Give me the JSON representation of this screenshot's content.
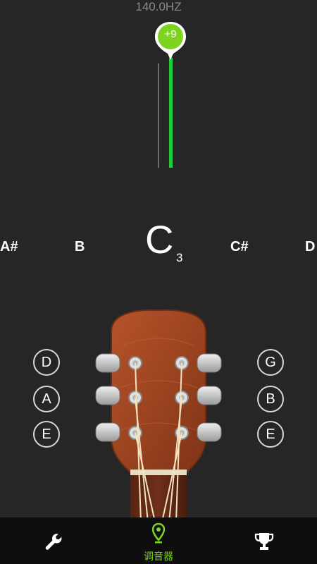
{
  "frequency": "140.0HZ",
  "offset_badge": "+9",
  "notes": {
    "far_left": "A#",
    "left": "B",
    "current": "C",
    "current_octave": "3",
    "right": "C#",
    "far_right": "D"
  },
  "strings": {
    "left": [
      "D",
      "A",
      "E"
    ],
    "right": [
      "G",
      "B",
      "E"
    ]
  },
  "nav": {
    "tools_icon": "wrench-icon",
    "tuner_icon": "location-pin-icon",
    "tuner_label": "调音器",
    "achievements_icon": "trophy-icon"
  },
  "colors": {
    "background": "#262626",
    "accent_green": "#7ed321",
    "meter_green": "#1fcc3a",
    "nav_background": "#0e0e0e"
  }
}
